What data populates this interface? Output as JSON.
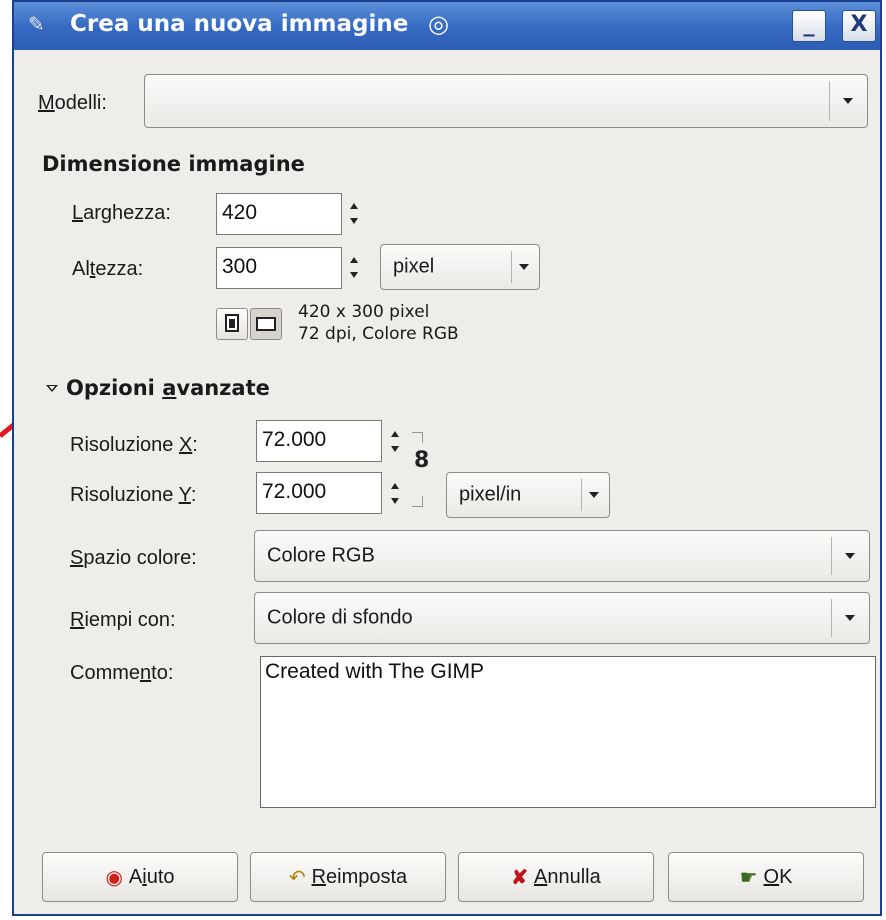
{
  "window": {
    "title": "Crea una nuova immagine",
    "minimize_label": "_",
    "close_label": "X"
  },
  "template": {
    "label": "Modelli:",
    "value": ""
  },
  "image_size": {
    "heading": "Dimensione immagine",
    "width_label": "Larghezza:",
    "width_value": "420",
    "height_label": "Altezza:",
    "height_value": "300",
    "unit": "pixel",
    "info_line1": "420 x 300 pixel",
    "info_line2": "72 dpi, Colore RGB"
  },
  "advanced": {
    "heading": "Opzioni avanzate",
    "res_x_label": "Risoluzione X:",
    "res_x_value": "72.000",
    "res_y_label": "Risoluzione Y:",
    "res_y_value": "72.000",
    "res_unit": "pixel/in",
    "colorspace_label": "Spazio colore:",
    "colorspace_value": "Colore RGB",
    "fill_label": "Riempi con:",
    "fill_value": "Colore di sfondo",
    "comment_label": "Commento:",
    "comment_value": "Created with The GIMP"
  },
  "buttons": {
    "help": "Aiuto",
    "reset": "Reimposta",
    "cancel": "Annulla",
    "ok": "OK"
  },
  "colors": {
    "titlebar": "#3569c1",
    "window_bg": "#efedea",
    "annotation_arrow": "#e0191e"
  }
}
